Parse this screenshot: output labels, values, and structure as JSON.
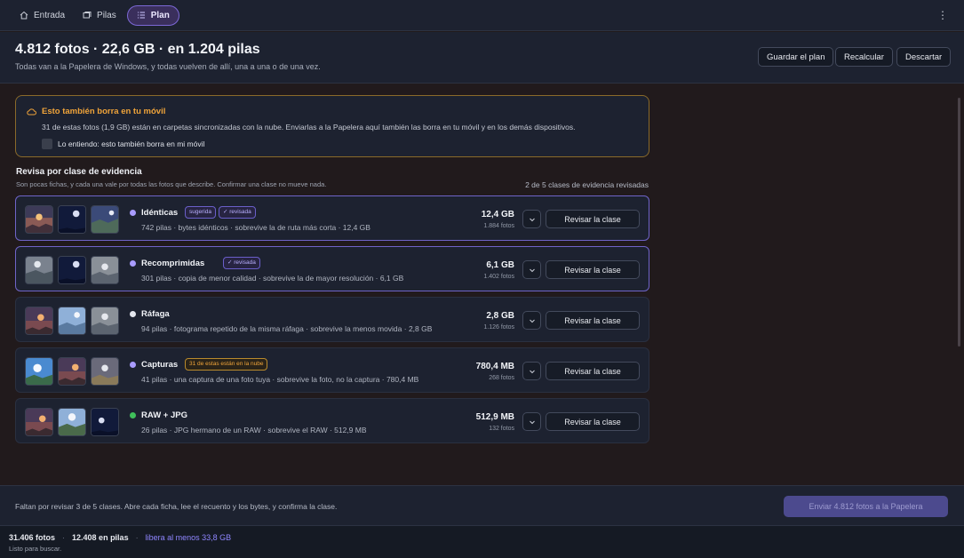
{
  "nav": {
    "tabs": [
      {
        "label": "Entrada",
        "icon": "home-icon"
      },
      {
        "label": "Pilas",
        "icon": "images-icon"
      },
      {
        "label": "Plan",
        "icon": "list-icon",
        "active": true
      }
    ],
    "more_icon": "more-vertical-icon"
  },
  "header": {
    "title": "4.812 fotos · 22,6 GB · en 1.204 pilas",
    "subtitle": "Todas van a la Papelera de Windows, y todas vuelven de allí, una a una o de una vez.",
    "buttons": {
      "save": "Guardar el plan",
      "recalc": "Recalcular",
      "discard": "Descartar"
    }
  },
  "warning": {
    "icon": "cloud-icon",
    "title": "Esto también borra en tu móvil",
    "body": "31 de estas fotos (1,9 GB) están en carpetas sincronizadas con la nube. Enviarlas a la Papelera aquí también las borra en tu móvil y en los demás dispositivos.",
    "checkbox_label": "Lo entiendo: esto también borra en mi móvil",
    "checked": false
  },
  "section": {
    "title": "Revisa por clase de evidencia",
    "subtitle": "Son pocas fichas, y cada una vale por todas las fotos que describe. Confirmar una clase no mueve nada.",
    "count": "2 de 5 clases de evidencia revisadas"
  },
  "classes": [
    {
      "name": "Idénticas",
      "dot_color": "#a99cff",
      "badges": [
        {
          "text": "sugerida",
          "kind": "info"
        },
        {
          "text": "✓ revisada",
          "kind": "info"
        }
      ],
      "desc": "742 pilas · bytes idénticos · sobrevive la de ruta más corta · 12,4 GB",
      "size": "12,4 GB",
      "count": "1.884 fotos",
      "button": "Revisar la clase",
      "highlight": true
    },
    {
      "name": "Recomprimidas",
      "dot_color": "#a99cff",
      "badges": [
        {
          "text": "✓ revisada",
          "kind": "info"
        }
      ],
      "desc": "301 pilas · copia de menor calidad · sobrevive la de mayor resolución · 6,1 GB",
      "size": "6,1 GB",
      "count": "1.402 fotos",
      "button": "Revisar la clase",
      "highlight": true
    },
    {
      "name": "Ráfaga",
      "dot_color": "#e4e6ee",
      "badges": [],
      "desc": "94 pilas · fotograma repetido de la misma ráfaga · sobrevive la menos movida · 2,8 GB",
      "size": "2,8 GB",
      "count": "1.126 fotos",
      "button": "Revisar la clase",
      "highlight": false
    },
    {
      "name": "Capturas",
      "dot_color": "#a99cff",
      "badges": [
        {
          "text": "31 de estas están en la nube",
          "kind": "warn"
        }
      ],
      "desc": "41 pilas · una captura de una foto tuya · sobrevive la foto, no la captura · 780,4 MB",
      "size": "780,4 MB",
      "count": "268 fotos",
      "button": "Revisar la clase",
      "highlight": false
    },
    {
      "name": "RAW + JPG",
      "dot_color": "#3fbf5a",
      "badges": [],
      "desc": "26 pilas · JPG hermano de un RAW · sobrevive el RAW · 512,9 MB",
      "size": "512,9 MB",
      "count": "132 fotos",
      "button": "Revisar la clase",
      "highlight": false
    }
  ],
  "footer": {
    "message": "Faltan por revisar 3 de 5 clases. Abre cada ficha, lee el recuento y los bytes, y confirma la clase.",
    "send_button": "Enviar 4.812 fotos a la Papelera"
  },
  "status": {
    "photos": "31.406 fotos",
    "stacks": "12.408 en pilas",
    "free": "libera al menos 33,8 GB",
    "text": "Listo para buscar."
  }
}
